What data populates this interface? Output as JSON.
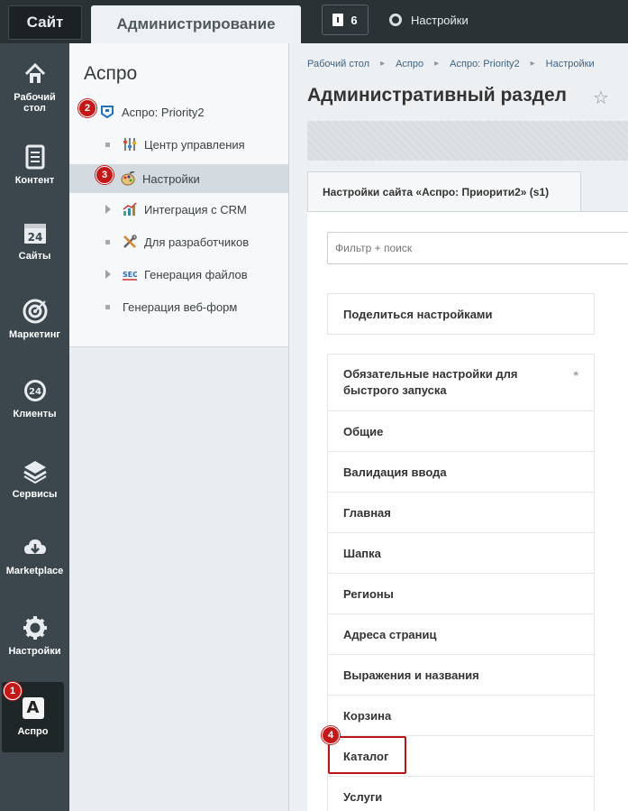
{
  "topbar": {
    "tab_site": "Сайт",
    "tab_admin": "Администрирование",
    "notifications_count": "6",
    "settings_label": "Настройки"
  },
  "leftnav": {
    "items": [
      {
        "label": "Рабочий стол",
        "icon": "home-icon"
      },
      {
        "label": "Контент",
        "icon": "document-icon"
      },
      {
        "label": "Сайты",
        "icon": "calendar-24-icon"
      },
      {
        "label": "Маркетинг",
        "icon": "target-icon"
      },
      {
        "label": "Клиенты",
        "icon": "clients-24-icon"
      },
      {
        "label": "Сервисы",
        "icon": "layers-icon"
      },
      {
        "label": "Marketplace",
        "icon": "cloud-download-icon"
      },
      {
        "label": "Настройки",
        "icon": "gear-icon"
      },
      {
        "label": "Аспро",
        "icon": "aspro-a-icon"
      }
    ]
  },
  "markers": [
    "1",
    "2",
    "3",
    "4"
  ],
  "midpanel": {
    "title": "Аспро",
    "tree": [
      {
        "label": "Аспро: Priority2"
      },
      {
        "label": "Центр управления"
      },
      {
        "label": "Настройки"
      },
      {
        "label": "Интеграция с CRM"
      },
      {
        "label": "Для разработчиков"
      },
      {
        "label": "Генерация файлов"
      },
      {
        "label": "Генерация веб-форм"
      }
    ]
  },
  "content": {
    "breadcrumb": [
      "Рабочий стол",
      "Аспро",
      "Аспро: Priority2",
      "Настройки"
    ],
    "title": "Административный раздел",
    "site_tab": "Настройки сайта «Аспро: Приорити2» (s1)",
    "filter_placeholder": "Фильтр + поиск",
    "share_label": "Поделиться настройками",
    "settings": [
      "Обязательные настройки для быстрого запуска",
      "Общие",
      "Валидация ввода",
      "Главная",
      "Шапка",
      "Регионы",
      "Адреса страниц",
      "Выражения и названия",
      "Корзина",
      "Каталог",
      "Услуги"
    ],
    "asterisk": "*"
  },
  "colors": {
    "accent_red": "#c41818",
    "sidebar_bg": "#3b474d"
  }
}
